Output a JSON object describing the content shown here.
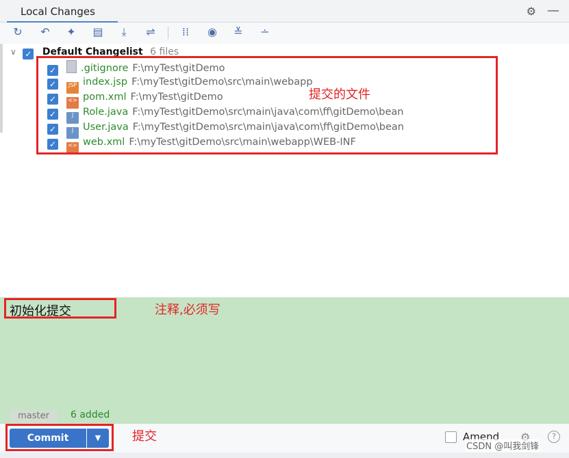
{
  "panel": {
    "tab_title": "Local Changes"
  },
  "toolbar": {
    "icons": [
      "refresh-icon",
      "rollback-icon",
      "diff-icon",
      "edit-icon",
      "update-icon",
      "move-icon",
      "group-icon",
      "view-icon",
      "expand-icon",
      "collapse-icon"
    ]
  },
  "changelist": {
    "name": "Default Changelist",
    "count": "6 files"
  },
  "files": [
    {
      "name": ".gitignore",
      "path": "F:\\myTest\\gitDemo",
      "icon": "plain-file-icon"
    },
    {
      "name": "index.jsp",
      "path": "F:\\myTest\\gitDemo\\src\\main\\webapp",
      "icon": "jsp-file-icon",
      "badge": "JSP"
    },
    {
      "name": "pom.xml",
      "path": "F:\\myTest\\gitDemo",
      "icon": "xml-file-icon",
      "badge": "<>"
    },
    {
      "name": "Role.java",
      "path": "F:\\myTest\\gitDemo\\src\\main\\java\\com\\ff\\gitDemo\\bean",
      "icon": "java-file-icon",
      "badge": "J"
    },
    {
      "name": "User.java",
      "path": "F:\\myTest\\gitDemo\\src\\main\\java\\com\\ff\\gitDemo\\bean",
      "icon": "java-file-icon",
      "badge": "J"
    },
    {
      "name": "web.xml",
      "path": "F:\\myTest\\gitDemo\\src\\main\\webapp\\WEB-INF",
      "icon": "xml-file-icon",
      "badge": "<>"
    }
  ],
  "annotations": {
    "files_note": "提交的文件",
    "message_note": "注释,必须写",
    "commit_note": "提交"
  },
  "commit": {
    "message": "初始化提交",
    "branch": "master",
    "summary": "6 added",
    "button_label": "Commit",
    "amend_label": "Amend"
  },
  "watermark": "CSDN @叫我剑锋",
  "colors": {
    "accent": "#3a74c8",
    "added_green": "#2c8a2c",
    "annotation_red": "#e32424",
    "commit_bg": "#c5e3c5"
  }
}
